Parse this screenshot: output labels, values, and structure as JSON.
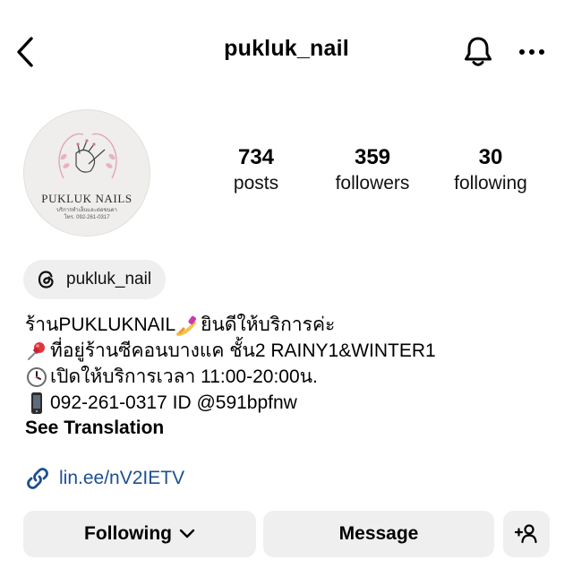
{
  "header": {
    "username": "pukluk_nail",
    "back_icon": "chevron-left-icon",
    "bell_icon": "bell-icon",
    "more_icon": "more-icon"
  },
  "avatar": {
    "brand": "PUKLUK NAILS",
    "tagline": "บริการทำเล็บและต่อขนตา",
    "phone": "โทร. 092-261-0317"
  },
  "stats": [
    {
      "value": "734",
      "label": "posts"
    },
    {
      "value": "359",
      "label": "followers"
    },
    {
      "value": "30",
      "label": "following"
    }
  ],
  "threads": {
    "icon": "threads-icon",
    "handle": "pukluk_nail"
  },
  "bio": {
    "lines": [
      {
        "icon": "",
        "text": "ร้านPUKLUKNAIL"
      },
      {
        "icon": "pushpin-icon",
        "text": "ที่อยู่ร้านซีคอนบางแค ชั้น2 RAINY1&WINTER1"
      },
      {
        "icon": "clock-icon",
        "text": "เปิดให้บริการเวลา 11:00-20:00น."
      },
      {
        "icon": "mobile-phone-icon",
        "text": "092-261-0317 ID @591bpfnw"
      }
    ],
    "line1_suffix": "ยินดีให้บริการค่ะ",
    "see_translation": "See Translation"
  },
  "link": {
    "icon": "link-icon",
    "text": "lin.ee/nV2IETV"
  },
  "actions": {
    "following_label": "Following",
    "message_label": "Message",
    "add_person_icon": "add-person-icon"
  },
  "colors": {
    "link": "#1d4f8f",
    "button_bg": "#efefef",
    "threads_bg": "#efefef"
  }
}
